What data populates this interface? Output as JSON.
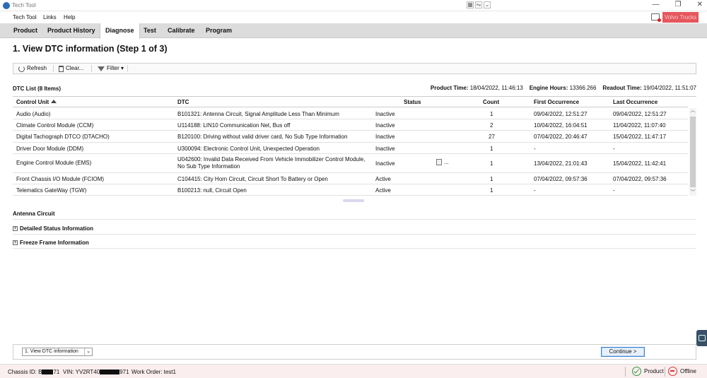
{
  "window": {
    "title": "Tech Tool",
    "mid_controls": [
      "▦",
      "⇋",
      "⌄"
    ],
    "controls": [
      "—",
      "❐",
      "✕"
    ]
  },
  "menu": {
    "items": [
      "Tech Tool",
      "Links",
      "Help"
    ],
    "brand": "Volvo Trucks"
  },
  "tabs": [
    "Product",
    "Product History",
    "Diagnose",
    "Test",
    "Calibrate",
    "Program"
  ],
  "active_tab": "Diagnose",
  "page": {
    "title": "1. View DTC information (Step 1 of 3)"
  },
  "toolbar": {
    "refresh": "Refresh",
    "clear": "Clear...",
    "filter": "Filter ▾"
  },
  "list": {
    "count_label": "DTC List (8 Items)",
    "product_time_label": "Product Time:",
    "product_time": "18/04/2022, 11:46:13",
    "engine_hours_label": "Engine Hours:",
    "engine_hours": "13366.266",
    "readout_time_label": "Readout Time:",
    "readout_time": "19/04/2022, 11:51:07"
  },
  "columns": [
    "Control Unit",
    "DTC",
    "Status",
    "Count",
    "First Occurrence",
    "Last Occurrence"
  ],
  "rows": [
    {
      "unit": "Audio (Audio)",
      "dtc": "B101321: Antenna Circuit, Signal Amplitude Less Than Minimum",
      "status": "Inactive",
      "count": "1",
      "first": "09/04/2022, 12:51:27",
      "last": "09/04/2022, 12:51:27"
    },
    {
      "unit": "Climate Control Module (CCM)",
      "dtc": "U114188: LIN10 Communication Net, Bus off",
      "status": "Inactive",
      "count": "2",
      "first": "10/04/2022, 16:04:51",
      "last": "11/04/2022, 11:07:40"
    },
    {
      "unit": "Digital Tachograph DTCO (DTACHO)",
      "dtc": "B120100: Driving without valid driver card, No Sub Type Information",
      "status": "Inactive",
      "count": "27",
      "first": "07/04/2022, 20:46:47",
      "last": "15/04/2022, 11:47:17"
    },
    {
      "unit": "Driver Door Module (DDM)",
      "dtc": "U300094: Electronic Control Unit, Unexpected Operation",
      "status": "Inactive",
      "count": "1",
      "first": "-",
      "last": "-"
    },
    {
      "unit": "Engine Control Module (EMS)",
      "dtc": "U042600: Invalid Data Received From Vehicle Immobilizer Control Module, No Sub Type Information",
      "status": "Inactive",
      "count": "1",
      "first": "13/04/2022, 21:01:43",
      "last": "15/04/2022, 11:42:41",
      "note": "..."
    },
    {
      "unit": "Front Chassis I/O Module (FCIOM)",
      "dtc": "C104415: City Horn Circuit, Circuit Short To Battery or Open",
      "status": "Active",
      "count": "1",
      "first": "07/04/2022, 09:57:36",
      "last": "07/04/2022, 09:57:36"
    },
    {
      "unit": "Telematics GateWay (TGW)",
      "dtc": "B100213: null, Circuit Open",
      "status": "Active",
      "count": "1",
      "first": "-",
      "last": "-"
    }
  ],
  "detail": {
    "title": "Antenna Circuit",
    "sections": [
      "Detailed Status Information",
      "Freeze Frame Information"
    ]
  },
  "bottom": {
    "step_select": "1. View DTC information",
    "continue": "Continue >"
  },
  "status": {
    "chassis_label": "Chassis ID: B",
    "chassis_tail": "71",
    "vin_label": "VIN: YV2RT40",
    "vin_tail": "971",
    "work_order": "Work Order: test1",
    "product": "Product",
    "offline": "Offline"
  }
}
